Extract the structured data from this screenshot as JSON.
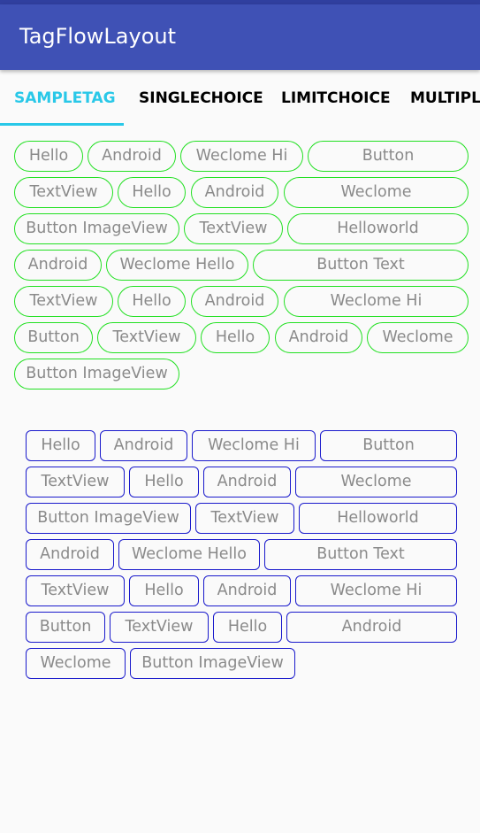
{
  "app": {
    "title": "TagFlowLayout"
  },
  "tabs": [
    {
      "label": "SAMPLETAG",
      "active": true
    },
    {
      "label": "SINGLECHOICE",
      "active": false
    },
    {
      "label": "LIMITCHOICE",
      "active": false
    },
    {
      "label": "MULTIPLE",
      "active": false
    }
  ],
  "colors": {
    "app_bar": "#3f51b5",
    "status_bar": "#303f9f",
    "tab_accent": "#29c8e8",
    "green_tag_border": "#22e022",
    "blue_tag_border": "#1a1acc",
    "tag_text": "#8a8a8a"
  },
  "green_tags": [
    "Hello",
    "Android",
    "Weclome Hi",
    "Button",
    "TextView",
    "Hello",
    "Android",
    "Weclome",
    "Button ImageView",
    "TextView",
    "Helloworld",
    "Android",
    "Weclome Hello",
    "Button Text",
    "TextView",
    "Hello",
    "Android",
    "Weclome Hi",
    "Button",
    "TextView",
    "Hello",
    "Android",
    "Weclome",
    "Button ImageView"
  ],
  "blue_tags": [
    "Hello",
    "Android",
    "Weclome Hi",
    "Button",
    "TextView",
    "Hello",
    "Android",
    "Weclome",
    "Button ImageView",
    "TextView",
    "Helloworld",
    "Android",
    "Weclome Hello",
    "Button Text",
    "TextView",
    "Hello",
    "Android",
    "Weclome Hi",
    "Button",
    "TextView",
    "Hello",
    "Android",
    "Weclome",
    "Button ImageView"
  ]
}
